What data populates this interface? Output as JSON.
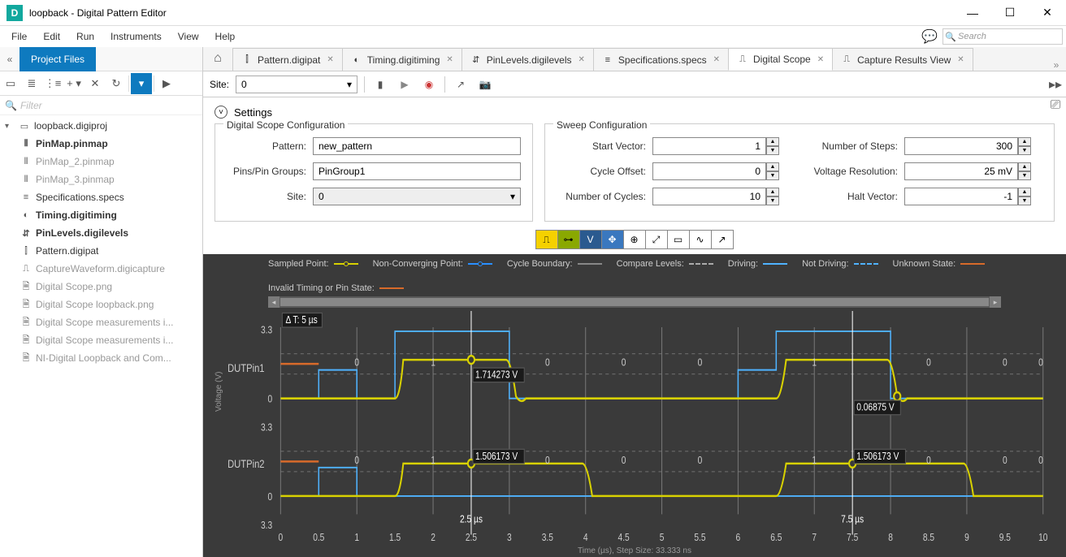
{
  "window": {
    "title": "loopback - Digital Pattern Editor",
    "app_badge": "D"
  },
  "menu": [
    "File",
    "Edit",
    "Run",
    "Instruments",
    "View",
    "Help"
  ],
  "search_placeholder": "Search",
  "sidebar": {
    "tab": "Project Files",
    "filter_placeholder": "Filter",
    "root": "loopback.digiproj",
    "items": [
      {
        "label": "PinMap.pinmap",
        "bold": true,
        "dim": false
      },
      {
        "label": "PinMap_2.pinmap",
        "bold": false,
        "dim": true
      },
      {
        "label": "PinMap_3.pinmap",
        "bold": false,
        "dim": true
      },
      {
        "label": "Specifications.specs",
        "bold": false,
        "dim": false
      },
      {
        "label": "Timing.digitiming",
        "bold": true,
        "dim": false
      },
      {
        "label": "PinLevels.digilevels",
        "bold": true,
        "dim": false
      },
      {
        "label": "Pattern.digipat",
        "bold": false,
        "dim": false
      },
      {
        "label": "CaptureWaveform.digicapture",
        "bold": false,
        "dim": true
      },
      {
        "label": "Digital Scope.png",
        "bold": false,
        "dim": true
      },
      {
        "label": "Digital Scope loopback.png",
        "bold": false,
        "dim": true
      },
      {
        "label": "Digital Scope measurements i...",
        "bold": false,
        "dim": true
      },
      {
        "label": "Digital Scope measurements i...",
        "bold": false,
        "dim": true
      },
      {
        "label": "NI-Digital Loopback and Com...",
        "bold": false,
        "dim": true
      }
    ]
  },
  "tabs": [
    {
      "label": "Pattern.digipat"
    },
    {
      "label": "Timing.digitiming"
    },
    {
      "label": "PinLevels.digilevels"
    },
    {
      "label": "Specifications.specs"
    },
    {
      "label": "Digital Scope",
      "active": true
    },
    {
      "label": "Capture Results View"
    }
  ],
  "toolbar": {
    "site_label": "Site:",
    "site_value": "0"
  },
  "settings": {
    "title": "Settings",
    "scope_conf": {
      "title": "Digital Scope Configuration",
      "pattern_label": "Pattern:",
      "pattern_value": "new_pattern",
      "pins_label": "Pins/Pin Groups:",
      "pins_value": "PinGroup1",
      "site_label": "Site:",
      "site_value": "0"
    },
    "sweep_conf": {
      "title": "Sweep Configuration",
      "start_vector_label": "Start Vector:",
      "start_vector_value": "1",
      "cycle_offset_label": "Cycle Offset:",
      "cycle_offset_value": "0",
      "num_cycles_label": "Number of Cycles:",
      "num_cycles_value": "10",
      "num_steps_label": "Number of Steps:",
      "num_steps_value": "300",
      "volt_res_label": "Voltage Resolution:",
      "volt_res_value": "25  mV",
      "halt_vector_label": "Halt Vector:",
      "halt_vector_value": "-1"
    }
  },
  "legend": {
    "sampled": "Sampled Point:",
    "nonconv": "Non-Converging Point:",
    "cycle": "Cycle Boundary:",
    "compare": "Compare Levels:",
    "driving": "Driving:",
    "notdriving": "Not Driving:",
    "unknown": "Unknown State:",
    "invalid": "Invalid Timing or Pin State:"
  },
  "scope": {
    "delta_t": "Δ T: 5 µs",
    "pin1": "DUTPin1",
    "pin2": "DUTPin2",
    "v_axis": "Voltage (V)",
    "t_axis": "Time (µs), Step Size: 33.333 ns",
    "cursor1_time": "2.5 µs",
    "cursor2_time": "7.5 µs",
    "p1_c1": "1.714273 V",
    "p1_c2": "0.06875 V",
    "p2_c1": "1.506173 V",
    "p2_c2": "1.506173 V",
    "yticks1": [
      "3.3",
      "0",
      "3.3",
      "0",
      "3.3"
    ],
    "xticks": [
      "0",
      "0.5",
      "1",
      "1.5",
      "2",
      "2.5",
      "3",
      "3.5",
      "4",
      "4.5",
      "5",
      "5.5",
      "6",
      "6.5",
      "7",
      "7.5",
      "8",
      "8.5",
      "9",
      "9.5",
      "10"
    ],
    "bits1": [
      "0",
      "1",
      "0",
      "0",
      "0",
      "1",
      "0",
      "0",
      "0"
    ],
    "bits2": [
      "0",
      "1",
      "0",
      "0",
      "0",
      "1",
      "0",
      "0",
      "0"
    ]
  },
  "chart_data": [
    {
      "type": "line",
      "title": "DUTPin1",
      "xlabel": "Time (µs)",
      "ylabel": "Voltage (V)",
      "ylim": [
        0,
        3.3
      ],
      "xlim": [
        0,
        10
      ],
      "x": [
        0,
        1,
        1,
        2,
        2,
        3,
        3,
        4,
        4,
        5,
        6,
        6,
        7,
        7,
        8,
        8,
        9,
        10
      ],
      "y": [
        0,
        0,
        0,
        0,
        1.7,
        1.7,
        1.7,
        1.7,
        0.07,
        0,
        0,
        0,
        1.7,
        1.7,
        1.7,
        1.7,
        0.07,
        0
      ],
      "cursors": [
        {
          "time_us": 2.5,
          "voltage_v": 1.714273
        },
        {
          "time_us": 7.5,
          "voltage_v": 0.06875
        }
      ],
      "bits": [
        "0",
        "1",
        "0",
        "0",
        "0",
        "1",
        "0",
        "0",
        "0"
      ]
    },
    {
      "type": "line",
      "title": "DUTPin2",
      "xlabel": "Time (µs)",
      "ylabel": "Voltage (V)",
      "ylim": [
        0,
        3.3
      ],
      "xlim": [
        0,
        10
      ],
      "x": [
        0,
        1,
        1,
        2,
        2,
        3,
        3,
        4,
        4,
        5,
        6,
        6,
        7,
        7,
        8,
        8,
        9,
        10
      ],
      "y": [
        0,
        0,
        0,
        0,
        1.5,
        1.5,
        1.5,
        1.5,
        0,
        0,
        0,
        0,
        1.5,
        1.5,
        1.5,
        1.5,
        0,
        0
      ],
      "cursors": [
        {
          "time_us": 2.5,
          "voltage_v": 1.506173
        },
        {
          "time_us": 7.5,
          "voltage_v": 1.506173
        }
      ],
      "bits": [
        "0",
        "1",
        "0",
        "0",
        "0",
        "1",
        "0",
        "0",
        "0"
      ]
    }
  ]
}
